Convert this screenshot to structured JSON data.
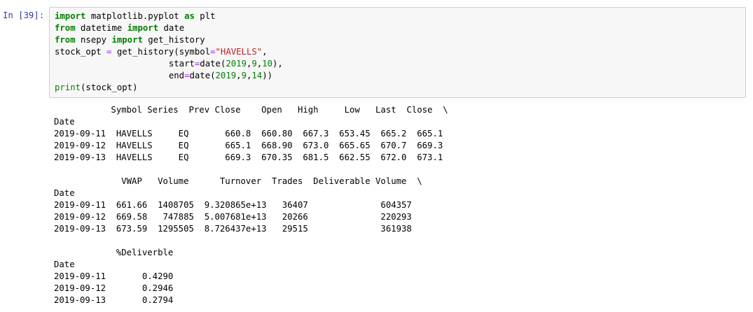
{
  "cell": {
    "prompt": "In [39]:",
    "code_lines": [
      [
        {
          "t": "import",
          "c": "kw"
        },
        {
          "t": " matplotlib.pyplot ",
          "c": ""
        },
        {
          "t": "as",
          "c": "kw"
        },
        {
          "t": " plt",
          "c": ""
        }
      ],
      [
        {
          "t": "from",
          "c": "kw"
        },
        {
          "t": " datetime ",
          "c": ""
        },
        {
          "t": "import",
          "c": "kw"
        },
        {
          "t": " date",
          "c": ""
        }
      ],
      [
        {
          "t": "from",
          "c": "kw"
        },
        {
          "t": " nsepy ",
          "c": ""
        },
        {
          "t": "import",
          "c": "kw"
        },
        {
          "t": " get_history",
          "c": ""
        }
      ],
      [
        {
          "t": "stock_opt ",
          "c": ""
        },
        {
          "t": "=",
          "c": "op"
        },
        {
          "t": " get_history(symbol",
          "c": ""
        },
        {
          "t": "=",
          "c": "op"
        },
        {
          "t": "\"HAVELLS\"",
          "c": "str"
        },
        {
          "t": ",",
          "c": ""
        }
      ],
      [
        {
          "t": "                      start",
          "c": ""
        },
        {
          "t": "=",
          "c": "op"
        },
        {
          "t": "date(",
          "c": ""
        },
        {
          "t": "2019",
          "c": "num"
        },
        {
          "t": ",",
          "c": ""
        },
        {
          "t": "9",
          "c": "num"
        },
        {
          "t": ",",
          "c": ""
        },
        {
          "t": "10",
          "c": "num"
        },
        {
          "t": "),",
          "c": ""
        }
      ],
      [
        {
          "t": "                      end",
          "c": ""
        },
        {
          "t": "=",
          "c": "op"
        },
        {
          "t": "date(",
          "c": ""
        },
        {
          "t": "2019",
          "c": "num"
        },
        {
          "t": ",",
          "c": ""
        },
        {
          "t": "9",
          "c": "num"
        },
        {
          "t": ",",
          "c": ""
        },
        {
          "t": "14",
          "c": "num"
        },
        {
          "t": "))",
          "c": ""
        }
      ],
      [
        {
          "t": "print",
          "c": "bi"
        },
        {
          "t": "(stock_opt)",
          "c": ""
        }
      ]
    ],
    "output_lines": [
      "           Symbol Series  Prev Close    Open   High     Low   Last  Close  \\",
      "Date",
      "2019-09-11  HAVELLS     EQ       660.8  660.80  667.3  653.45  665.2  665.1",
      "2019-09-12  HAVELLS     EQ       665.1  668.90  673.0  665.65  670.7  669.3",
      "2019-09-13  HAVELLS     EQ       669.3  670.35  681.5  662.55  672.0  673.1",
      "",
      "             VWAP   Volume      Turnover  Trades  Deliverable Volume  \\",
      "Date",
      "2019-09-11  661.66  1408705  9.320865e+13   36407              604357",
      "2019-09-12  669.58   747885  5.007681e+13   20266              220293",
      "2019-09-13  673.59  1295505  8.726437e+13   29515              361938",
      "",
      "            %Deliverble",
      "Date",
      "2019-09-11       0.4290",
      "2019-09-12       0.2946",
      "2019-09-13       0.2794"
    ]
  }
}
